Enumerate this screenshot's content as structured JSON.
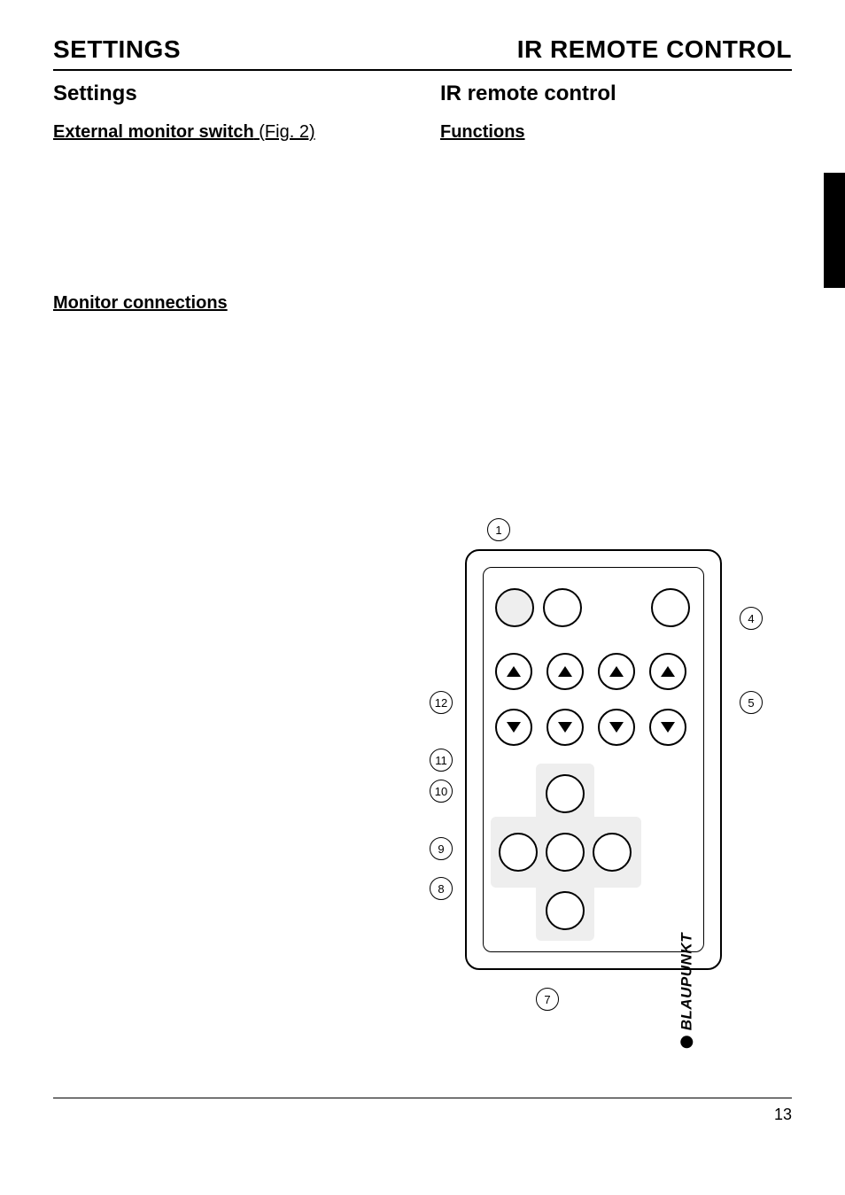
{
  "header": {
    "left": "SETTINGS",
    "right": "IR REMOTE CONTROL"
  },
  "leftCol": {
    "title": "Settings",
    "extMonitorBold": "External monitor switch",
    "extMonitorRest": " (Fig. 2)",
    "monitorConnections": "Monitor connections"
  },
  "rightCol": {
    "title": "IR remote control",
    "functions": "Functions"
  },
  "brand": "BLAUPUNKT",
  "callouts": {
    "c1": "1",
    "c4": "4",
    "c5": "5",
    "c7": "7",
    "c8": "8",
    "c9": "9",
    "c10": "10",
    "c11": "11",
    "c12": "12"
  },
  "pageNumber": "13"
}
